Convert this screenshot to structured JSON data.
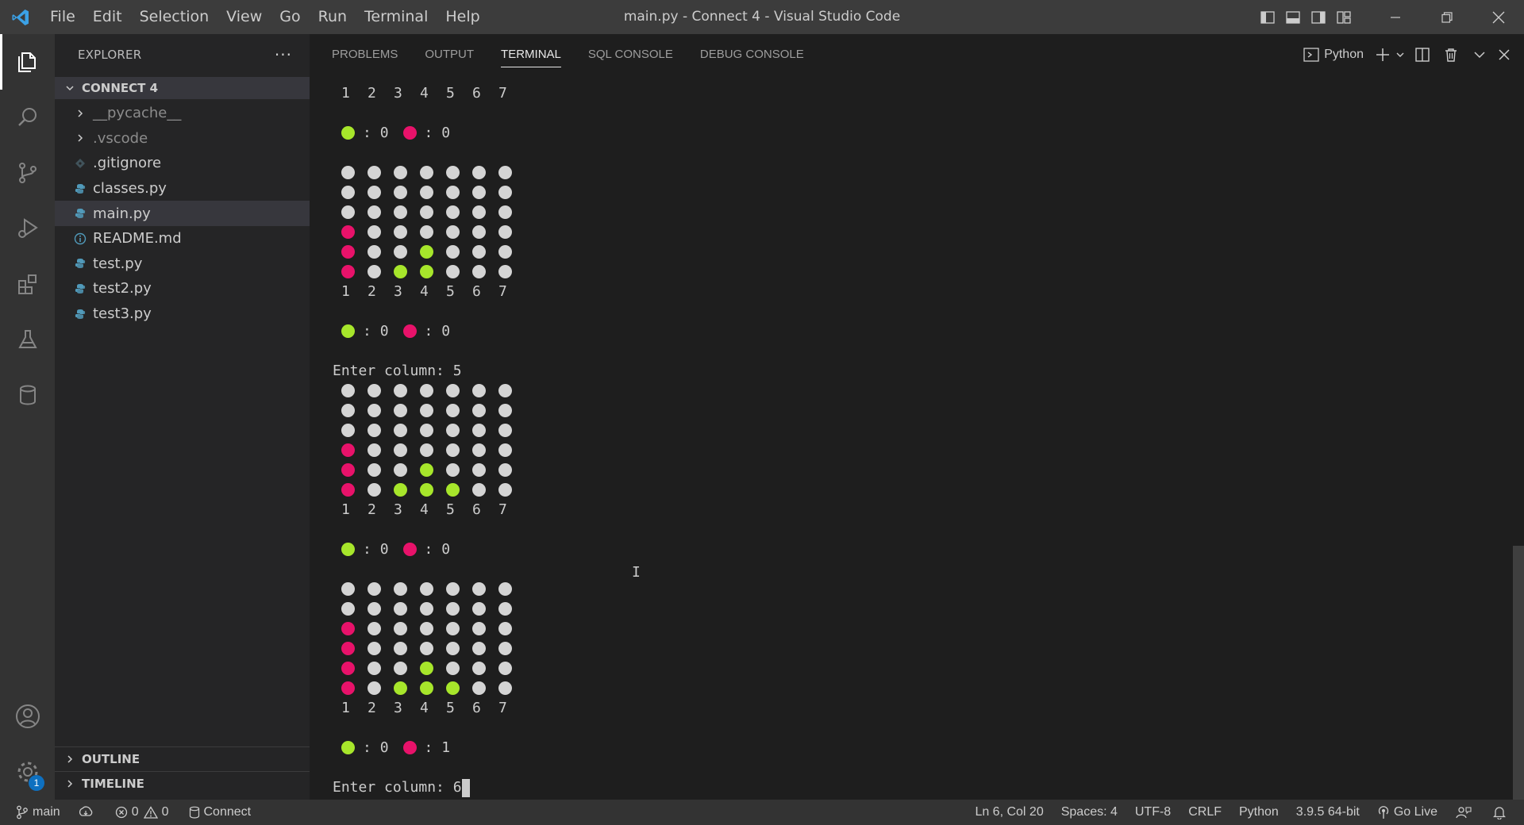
{
  "window": {
    "title": "main.py - Connect 4 - Visual Studio Code"
  },
  "menu": [
    "File",
    "Edit",
    "Selection",
    "View",
    "Go",
    "Run",
    "Terminal",
    "Help"
  ],
  "explorer": {
    "header": "EXPLORER",
    "more": "···",
    "folder": "CONNECT 4",
    "files": [
      {
        "name": "__pycache__",
        "type": "folder"
      },
      {
        "name": ".vscode",
        "type": "folder"
      },
      {
        "name": ".gitignore",
        "type": "gitignore"
      },
      {
        "name": "classes.py",
        "type": "python"
      },
      {
        "name": "main.py",
        "type": "python",
        "selected": true
      },
      {
        "name": "README.md",
        "type": "info"
      },
      {
        "name": "test.py",
        "type": "python"
      },
      {
        "name": "test2.py",
        "type": "python"
      },
      {
        "name": "test3.py",
        "type": "python"
      }
    ],
    "outline": "OUTLINE",
    "timeline": "TIMELINE"
  },
  "activity": {
    "settings_badge": "1"
  },
  "panel": {
    "tabs": [
      "PROBLEMS",
      "OUTPUT",
      "TERMINAL",
      "SQL CONSOLE",
      "DEBUG CONSOLE"
    ],
    "active_tab": "TERMINAL",
    "terminal_name": "Python"
  },
  "colors": {
    "green": "#a7e62b",
    "red": "#e8126a",
    "empty": "#d4d4d4",
    "accent": "#0e70c0"
  },
  "terminal": {
    "lines": [
      {
        "type": "nums",
        "values": [
          "1",
          "2",
          "3",
          "4",
          "5",
          "6",
          "7"
        ]
      },
      {
        "type": "blank"
      },
      {
        "type": "score",
        "green": "0",
        "red": "0"
      },
      {
        "type": "blank"
      },
      {
        "type": "board",
        "rows": [
          "EEEEEEE",
          "EEEEEEE",
          "EEEEEEE",
          "REEEEEE",
          "REEGEEE",
          "REGGEEE"
        ]
      },
      {
        "type": "nums",
        "values": [
          "1",
          "2",
          "3",
          "4",
          "5",
          "6",
          "7"
        ]
      },
      {
        "type": "blank"
      },
      {
        "type": "score",
        "green": "0",
        "red": "0"
      },
      {
        "type": "blank"
      },
      {
        "type": "text",
        "text": "Enter column: 5"
      },
      {
        "type": "board",
        "rows": [
          "EEEEEEE",
          "EEEEEEE",
          "EEEEEEE",
          "REEEEEE",
          "REEGEEE",
          "REGGGEE"
        ]
      },
      {
        "type": "nums",
        "values": [
          "1",
          "2",
          "3",
          "4",
          "5",
          "6",
          "7"
        ]
      },
      {
        "type": "blank"
      },
      {
        "type": "score",
        "green": "0",
        "red": "0"
      },
      {
        "type": "blank"
      },
      {
        "type": "board",
        "rows": [
          "EEEEEEE",
          "EEEEEEE",
          "REEEEEE",
          "REEEEEE",
          "REEGEEE",
          "REGGGEE"
        ]
      },
      {
        "type": "nums",
        "values": [
          "1",
          "2",
          "3",
          "4",
          "5",
          "6",
          "7"
        ]
      },
      {
        "type": "blank"
      },
      {
        "type": "score",
        "green": "0",
        "red": "1"
      },
      {
        "type": "blank"
      },
      {
        "type": "input",
        "text": "Enter column: 6"
      }
    ]
  },
  "status": {
    "branch": "main",
    "errors": "0",
    "warnings": "0",
    "connect": "Connect",
    "position": "Ln 6, Col 20",
    "spaces": "Spaces: 4",
    "encoding": "UTF-8",
    "eol": "CRLF",
    "language": "Python",
    "interpreter": "3.9.5 64-bit",
    "golive": "Go Live"
  }
}
